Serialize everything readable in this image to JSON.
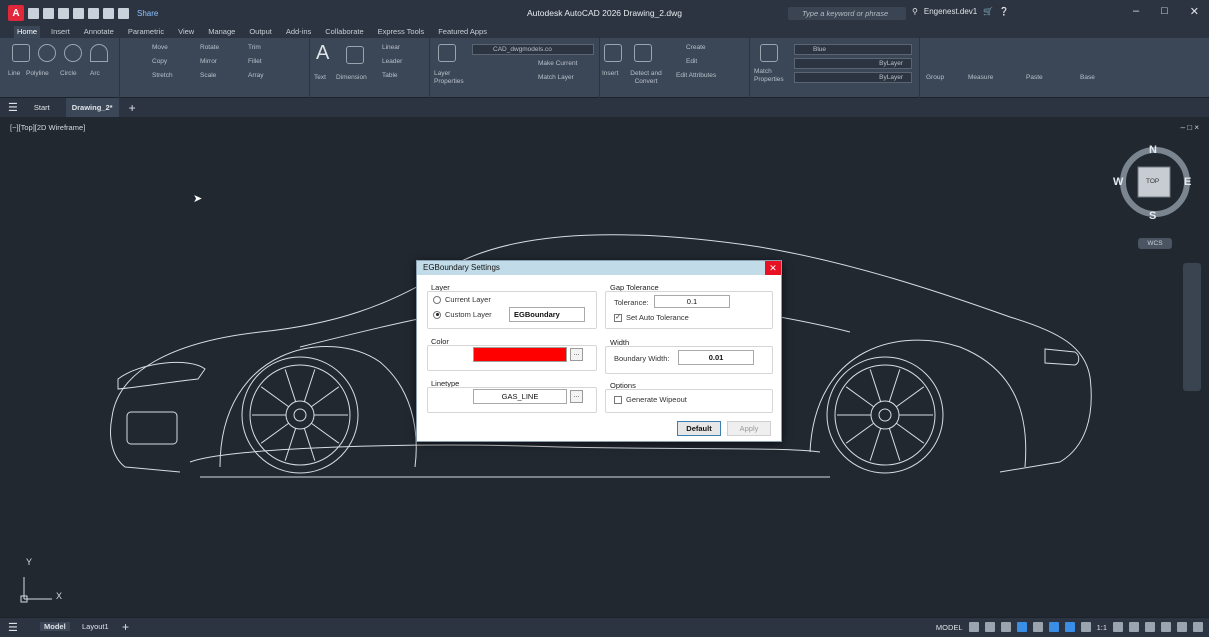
{
  "app": {
    "title": "Autodesk AutoCAD 2026  Drawing_2.dwg",
    "logo_letter": "A",
    "share_label": "Share",
    "search_placeholder": "Type a keyword or phrase",
    "user": "Engenest.dev1"
  },
  "ribbon_tabs": [
    {
      "label": "Home",
      "active": true
    },
    {
      "label": "Insert"
    },
    {
      "label": "Annotate"
    },
    {
      "label": "Parametric"
    },
    {
      "label": "View"
    },
    {
      "label": "Manage"
    },
    {
      "label": "Output"
    },
    {
      "label": "Add-ins"
    },
    {
      "label": "Collaborate"
    },
    {
      "label": "Express Tools"
    },
    {
      "label": "Featured Apps"
    }
  ],
  "ribbon": {
    "draw": [
      "Line",
      "Polyline",
      "Circle",
      "Arc"
    ],
    "modify": [
      "Move",
      "Rotate",
      "Trim",
      "Copy",
      "Mirror",
      "Fillet",
      "Stretch",
      "Scale",
      "Array"
    ],
    "annotation": [
      "Text",
      "Dimension",
      "Linear",
      "Leader",
      "Table"
    ],
    "layers": [
      "Layer Properties",
      "Make Current",
      "Match Layer"
    ],
    "layer_name": "CAD_dwgmodels.co",
    "block": [
      "Insert",
      "Create",
      "Edit",
      "Edit Attributes"
    ],
    "detect": "Detect and Convert",
    "properties": [
      "Match Properties",
      "ByLayer",
      "ByLayer"
    ],
    "color_name": "Blue",
    "groups": [
      "Group",
      "Measure",
      "Paste",
      "Base"
    ]
  },
  "doc_tabs": {
    "start": "Start",
    "drawing": "Drawing_2*"
  },
  "viewport": {
    "label": "[−][Top][2D Wireframe]",
    "controls": "– □ ×",
    "viewcube": {
      "n": "N",
      "s": "S",
      "e": "E",
      "w": "W",
      "face": "TOP"
    },
    "wcs": "WCS",
    "ucs_x": "X",
    "ucs_y": "Y"
  },
  "dialog": {
    "title": "EGBoundary Settings",
    "layer_group": "Layer",
    "current_layer": "Current Layer",
    "custom_layer": "Custom Layer",
    "custom_layer_value": "EGBoundary",
    "color_group": "Color",
    "color_value": "#ff0000",
    "linetype_group": "Linetype",
    "linetype_value": "GAS_LINE",
    "gap_group": "Gap Tolerance",
    "tolerance_label": "Tolerance:",
    "tolerance_value": "0.1",
    "auto_tolerance": "Set Auto Tolerance",
    "width_group": "Width",
    "boundary_width_label": "Boundary Width:",
    "boundary_width_value": "0.01",
    "options_group": "Options",
    "wipeout": "Generate Wipeout",
    "default_btn": "Default",
    "apply_btn": "Apply",
    "browse": "..."
  },
  "status": {
    "model_tab": "Model",
    "layout_tab": "Layout1",
    "model_label": "MODEL",
    "scale": "1:1"
  }
}
